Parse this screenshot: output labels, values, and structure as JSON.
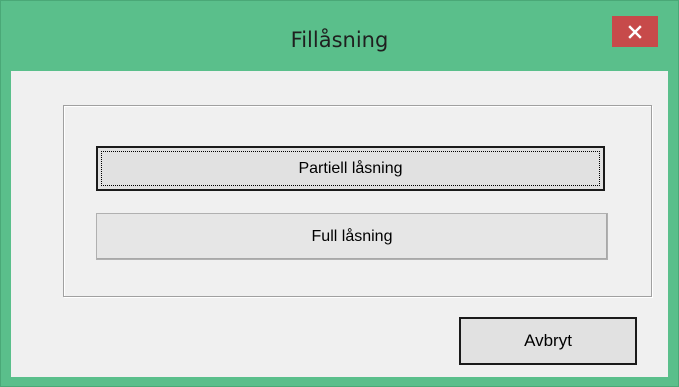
{
  "dialog": {
    "title": "Fillåsning",
    "close_icon": "close-icon",
    "accent_color": "#5abf8b",
    "close_color": "#c74a4a"
  },
  "options": {
    "partial_label": "Partiell låsning",
    "full_label": "Full låsning"
  },
  "footer": {
    "cancel_label": "Avbryt"
  }
}
